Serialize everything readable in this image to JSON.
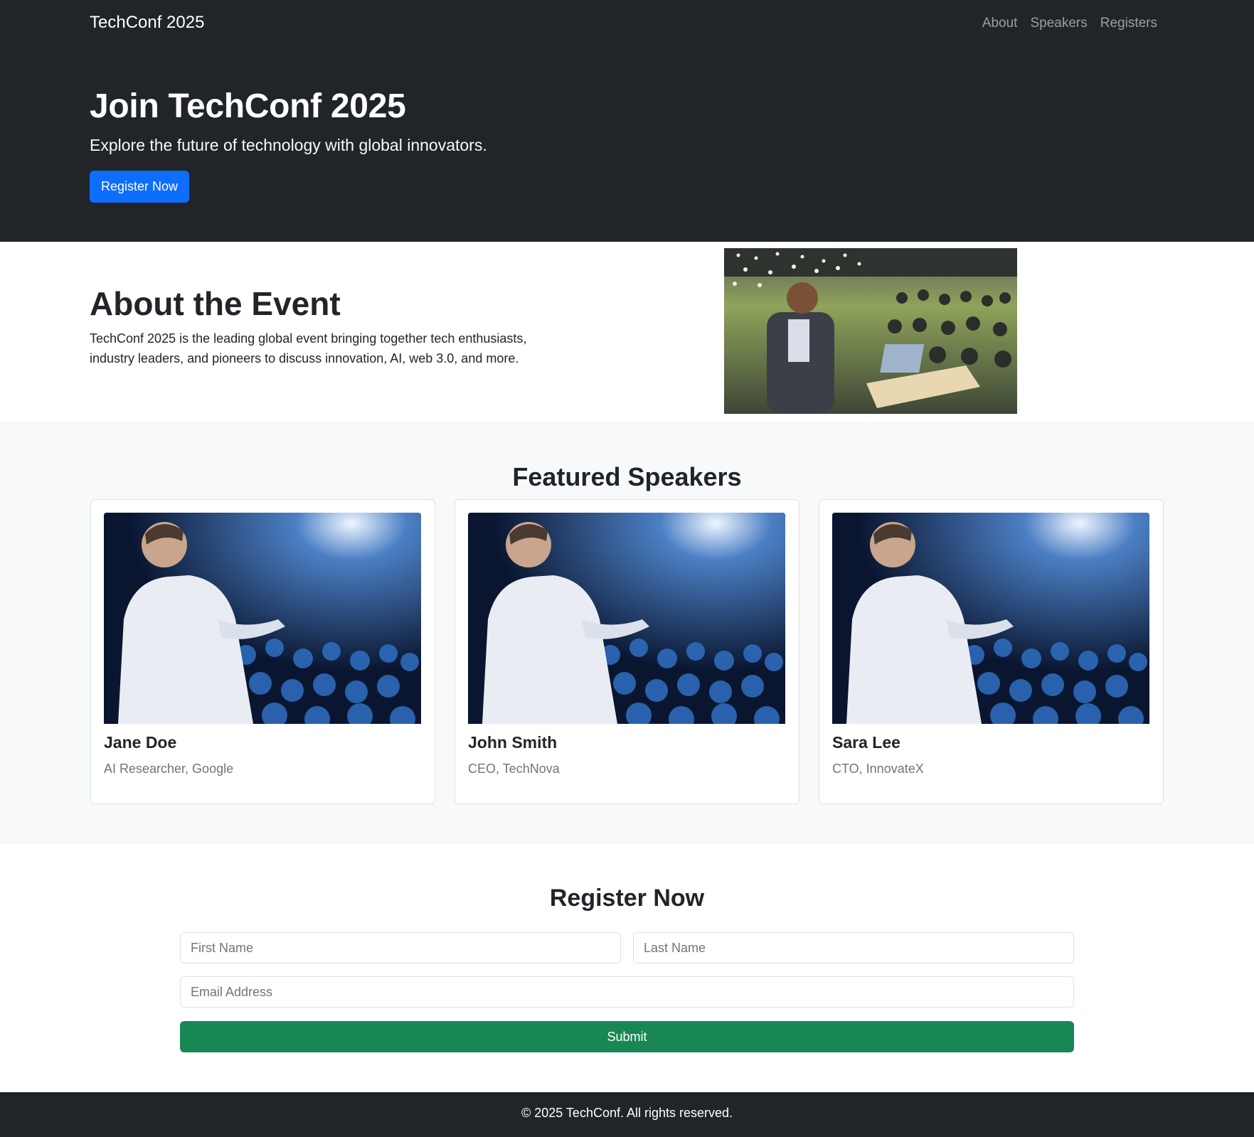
{
  "nav": {
    "brand": "TechConf 2025",
    "links": [
      "About",
      "Speakers",
      "Registers"
    ]
  },
  "hero": {
    "title": "Join TechConf 2025",
    "subtitle": "Explore the future of technology with global innovators.",
    "cta": "Register Now"
  },
  "about": {
    "title": "About the Event",
    "text": "TechConf 2025 is the leading global event bringing together tech enthusiasts, industry leaders, and pioneers to discuss innovation, AI, web 3.0, and more."
  },
  "speakers": {
    "title": "Featured Speakers",
    "items": [
      {
        "name": "Jane Doe",
        "role": "AI Researcher, Google"
      },
      {
        "name": "John Smith",
        "role": "CEO, TechNova"
      },
      {
        "name": "Sara Lee",
        "role": "CTO, InnovateX"
      }
    ]
  },
  "register": {
    "title": "Register Now",
    "first_name_placeholder": "First Name",
    "last_name_placeholder": "Last Name",
    "email_placeholder": "Email Address",
    "first_name_value": "",
    "last_name_value": "",
    "email_value": "",
    "submit_label": "Submit"
  },
  "footer": {
    "text": "© 2025 TechConf. All rights reserved."
  },
  "colors": {
    "dark": "#212529",
    "primary": "#0d6efd",
    "success": "#198754",
    "light": "#f8f9fa",
    "muted": "#6c757d"
  }
}
